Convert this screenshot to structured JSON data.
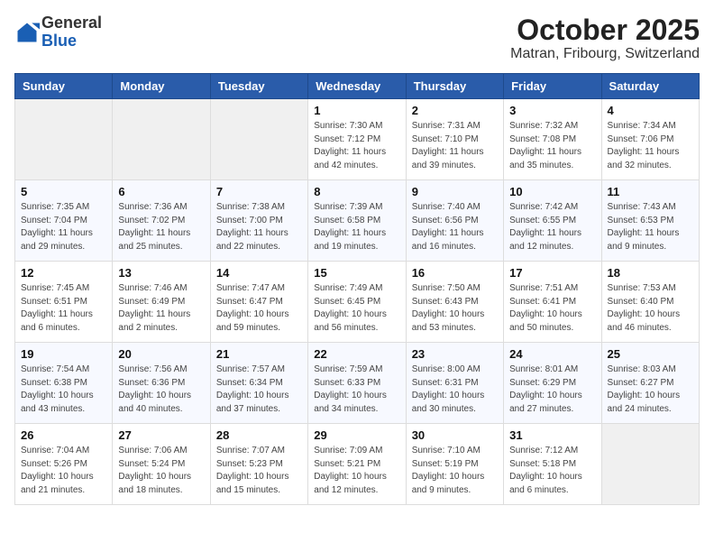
{
  "header": {
    "logo_line1": "General",
    "logo_line2": "Blue",
    "month": "October 2025",
    "location": "Matran, Fribourg, Switzerland"
  },
  "weekdays": [
    "Sunday",
    "Monday",
    "Tuesday",
    "Wednesday",
    "Thursday",
    "Friday",
    "Saturday"
  ],
  "weeks": [
    [
      {
        "day": "",
        "info": ""
      },
      {
        "day": "",
        "info": ""
      },
      {
        "day": "",
        "info": ""
      },
      {
        "day": "1",
        "info": "Sunrise: 7:30 AM\nSunset: 7:12 PM\nDaylight: 11 hours\nand 42 minutes."
      },
      {
        "day": "2",
        "info": "Sunrise: 7:31 AM\nSunset: 7:10 PM\nDaylight: 11 hours\nand 39 minutes."
      },
      {
        "day": "3",
        "info": "Sunrise: 7:32 AM\nSunset: 7:08 PM\nDaylight: 11 hours\nand 35 minutes."
      },
      {
        "day": "4",
        "info": "Sunrise: 7:34 AM\nSunset: 7:06 PM\nDaylight: 11 hours\nand 32 minutes."
      }
    ],
    [
      {
        "day": "5",
        "info": "Sunrise: 7:35 AM\nSunset: 7:04 PM\nDaylight: 11 hours\nand 29 minutes."
      },
      {
        "day": "6",
        "info": "Sunrise: 7:36 AM\nSunset: 7:02 PM\nDaylight: 11 hours\nand 25 minutes."
      },
      {
        "day": "7",
        "info": "Sunrise: 7:38 AM\nSunset: 7:00 PM\nDaylight: 11 hours\nand 22 minutes."
      },
      {
        "day": "8",
        "info": "Sunrise: 7:39 AM\nSunset: 6:58 PM\nDaylight: 11 hours\nand 19 minutes."
      },
      {
        "day": "9",
        "info": "Sunrise: 7:40 AM\nSunset: 6:56 PM\nDaylight: 11 hours\nand 16 minutes."
      },
      {
        "day": "10",
        "info": "Sunrise: 7:42 AM\nSunset: 6:55 PM\nDaylight: 11 hours\nand 12 minutes."
      },
      {
        "day": "11",
        "info": "Sunrise: 7:43 AM\nSunset: 6:53 PM\nDaylight: 11 hours\nand 9 minutes."
      }
    ],
    [
      {
        "day": "12",
        "info": "Sunrise: 7:45 AM\nSunset: 6:51 PM\nDaylight: 11 hours\nand 6 minutes."
      },
      {
        "day": "13",
        "info": "Sunrise: 7:46 AM\nSunset: 6:49 PM\nDaylight: 11 hours\nand 2 minutes."
      },
      {
        "day": "14",
        "info": "Sunrise: 7:47 AM\nSunset: 6:47 PM\nDaylight: 10 hours\nand 59 minutes."
      },
      {
        "day": "15",
        "info": "Sunrise: 7:49 AM\nSunset: 6:45 PM\nDaylight: 10 hours\nand 56 minutes."
      },
      {
        "day": "16",
        "info": "Sunrise: 7:50 AM\nSunset: 6:43 PM\nDaylight: 10 hours\nand 53 minutes."
      },
      {
        "day": "17",
        "info": "Sunrise: 7:51 AM\nSunset: 6:41 PM\nDaylight: 10 hours\nand 50 minutes."
      },
      {
        "day": "18",
        "info": "Sunrise: 7:53 AM\nSunset: 6:40 PM\nDaylight: 10 hours\nand 46 minutes."
      }
    ],
    [
      {
        "day": "19",
        "info": "Sunrise: 7:54 AM\nSunset: 6:38 PM\nDaylight: 10 hours\nand 43 minutes."
      },
      {
        "day": "20",
        "info": "Sunrise: 7:56 AM\nSunset: 6:36 PM\nDaylight: 10 hours\nand 40 minutes."
      },
      {
        "day": "21",
        "info": "Sunrise: 7:57 AM\nSunset: 6:34 PM\nDaylight: 10 hours\nand 37 minutes."
      },
      {
        "day": "22",
        "info": "Sunrise: 7:59 AM\nSunset: 6:33 PM\nDaylight: 10 hours\nand 34 minutes."
      },
      {
        "day": "23",
        "info": "Sunrise: 8:00 AM\nSunset: 6:31 PM\nDaylight: 10 hours\nand 30 minutes."
      },
      {
        "day": "24",
        "info": "Sunrise: 8:01 AM\nSunset: 6:29 PM\nDaylight: 10 hours\nand 27 minutes."
      },
      {
        "day": "25",
        "info": "Sunrise: 8:03 AM\nSunset: 6:27 PM\nDaylight: 10 hours\nand 24 minutes."
      }
    ],
    [
      {
        "day": "26",
        "info": "Sunrise: 7:04 AM\nSunset: 5:26 PM\nDaylight: 10 hours\nand 21 minutes."
      },
      {
        "day": "27",
        "info": "Sunrise: 7:06 AM\nSunset: 5:24 PM\nDaylight: 10 hours\nand 18 minutes."
      },
      {
        "day": "28",
        "info": "Sunrise: 7:07 AM\nSunset: 5:23 PM\nDaylight: 10 hours\nand 15 minutes."
      },
      {
        "day": "29",
        "info": "Sunrise: 7:09 AM\nSunset: 5:21 PM\nDaylight: 10 hours\nand 12 minutes."
      },
      {
        "day": "30",
        "info": "Sunrise: 7:10 AM\nSunset: 5:19 PM\nDaylight: 10 hours\nand 9 minutes."
      },
      {
        "day": "31",
        "info": "Sunrise: 7:12 AM\nSunset: 5:18 PM\nDaylight: 10 hours\nand 6 minutes."
      },
      {
        "day": "",
        "info": ""
      }
    ]
  ]
}
